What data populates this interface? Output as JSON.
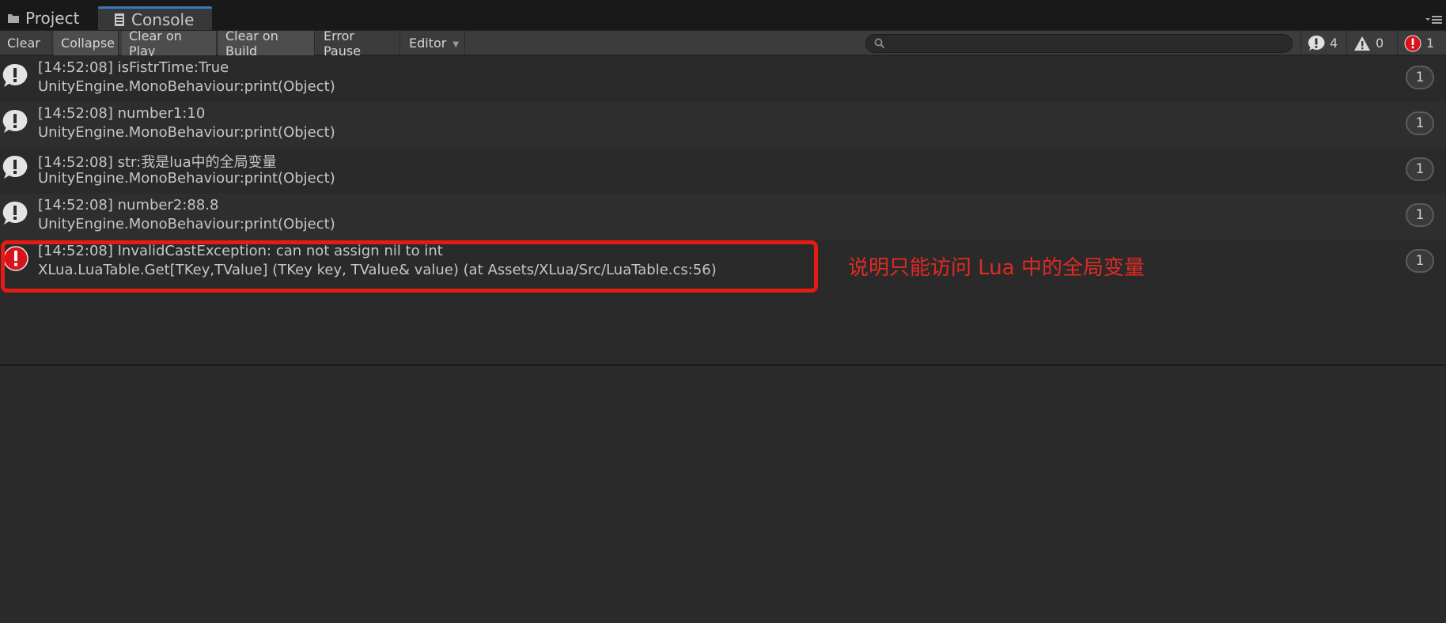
{
  "tabs": {
    "project": "Project",
    "console": "Console"
  },
  "toolbar": {
    "clear": "Clear",
    "collapse": "Collapse",
    "clear_on_play": "Clear on Play",
    "clear_on_build": "Clear on Build",
    "error_pause": "Error Pause",
    "editor": "Editor"
  },
  "search": {
    "value": ""
  },
  "counters": {
    "info": "4",
    "warning": "0",
    "error": "1"
  },
  "entries": [
    {
      "type": "info",
      "line1": "[14:52:08] isFistrTime:True",
      "line2": "UnityEngine.MonoBehaviour:print(Object)",
      "count": "1"
    },
    {
      "type": "info",
      "line1": "[14:52:08] number1:10",
      "line2": "UnityEngine.MonoBehaviour:print(Object)",
      "count": "1"
    },
    {
      "type": "info",
      "line1": "[14:52:08] str:我是lua中的全局变量",
      "line2": "UnityEngine.MonoBehaviour:print(Object)",
      "count": "1"
    },
    {
      "type": "info",
      "line1": "[14:52:08] number2:88.8",
      "line2": "UnityEngine.MonoBehaviour:print(Object)",
      "count": "1"
    },
    {
      "type": "error",
      "line1": "[14:52:08] InvalidCastException: can not assign nil to int",
      "line2": "XLua.LuaTable.Get[TKey,TValue] (TKey key, TValue& value) (at Assets/XLua/Src/LuaTable.cs:56)",
      "count": "1"
    }
  ],
  "annotation": "说明只能访问 Lua 中的全局变量",
  "colors": {
    "accent": "#3a79bb",
    "error": "#d7141c",
    "highlight": "#e51b14"
  }
}
